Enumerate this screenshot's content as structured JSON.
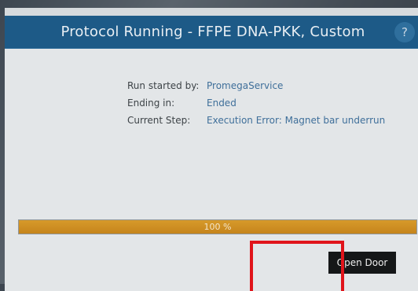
{
  "dialog": {
    "title": "Protocol Running - FFPE DNA-PKK, Custom",
    "help_icon": "?"
  },
  "run_info": {
    "rows": [
      {
        "label": "Run started by:",
        "value": "PromegaService"
      },
      {
        "label": "Ending in:",
        "value": "Ended"
      },
      {
        "label": "Current Step:",
        "value": "Execution Error: Magnet bar underrun"
      }
    ]
  },
  "progress": {
    "percent": 100,
    "label": "100 %"
  },
  "buttons": {
    "open_door": "Open Door"
  },
  "colors": {
    "title_bar": "#1d5a87",
    "progress_fill": "#d08f24",
    "value_text": "#3f6f9a",
    "highlight": "#e0141b"
  }
}
